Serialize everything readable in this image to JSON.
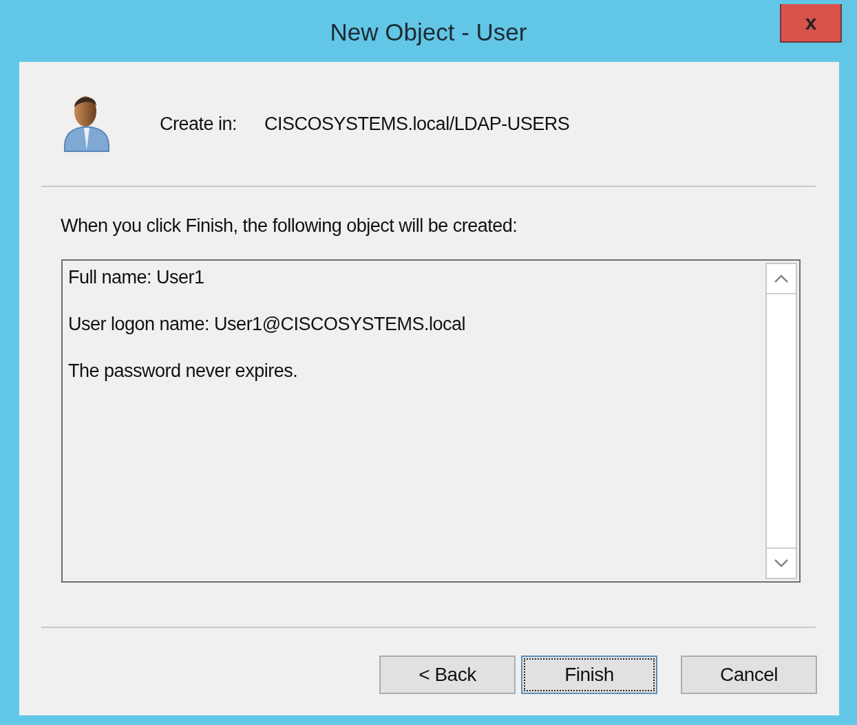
{
  "window": {
    "title": "New Object - User",
    "close_label": "x"
  },
  "header": {
    "label": "Create in:",
    "value": "CISCOSYSTEMS.local/LDAP-USERS"
  },
  "intro": "When you click Finish, the following object will be created:",
  "summary": [
    "Full name: User1",
    "User logon name: User1@CISCOSYSTEMS.local",
    "The password never expires."
  ],
  "buttons": [
    {
      "label": "< Back",
      "focused": false
    },
    {
      "label": "Finish",
      "focused": true
    },
    {
      "label": "Cancel",
      "focused": false
    }
  ]
}
